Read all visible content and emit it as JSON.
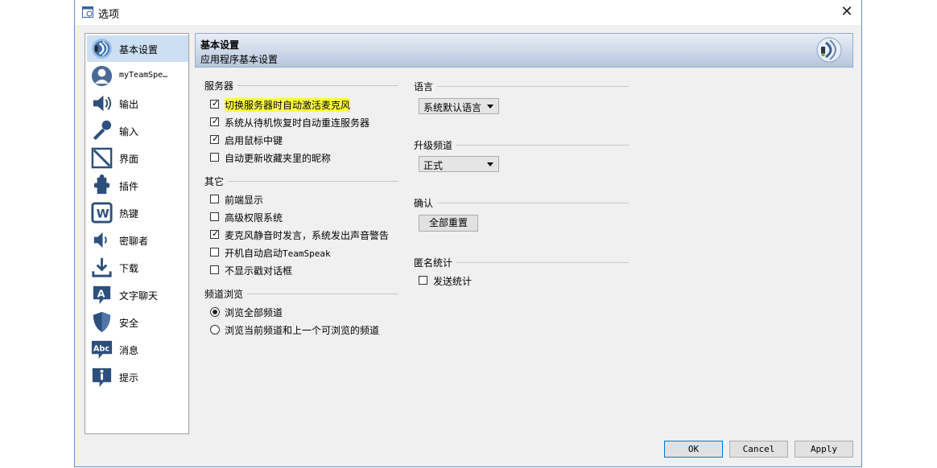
{
  "window": {
    "title": "选项",
    "close_glyph": "✕"
  },
  "sidebar": {
    "items": [
      {
        "label": "基本设置",
        "icon": "teamspeak-icon"
      },
      {
        "label": "myTeamSpe…",
        "icon": "user-icon"
      },
      {
        "label": "输出",
        "icon": "speaker-icon"
      },
      {
        "label": "输入",
        "icon": "microphone-icon"
      },
      {
        "label": "界面",
        "icon": "design-icon"
      },
      {
        "label": "插件",
        "icon": "puzzle-icon"
      },
      {
        "label": "热键",
        "icon": "keyboard-key-icon"
      },
      {
        "label": "密聊者",
        "icon": "whisper-icon"
      },
      {
        "label": "下载",
        "icon": "download-icon"
      },
      {
        "label": "文字聊天",
        "icon": "chat-icon"
      },
      {
        "label": "安全",
        "icon": "shield-icon"
      },
      {
        "label": "消息",
        "icon": "messages-icon"
      },
      {
        "label": "提示",
        "icon": "info-icon"
      }
    ],
    "selected_index": 0
  },
  "header": {
    "title": "基本设置",
    "subtitle": "应用程序基本设置"
  },
  "groups": {
    "server": {
      "title": "服务器",
      "options": [
        {
          "label": "切换服务器时自动激活麦克风",
          "checked": true
        },
        {
          "label": "系统从待机恢复时自动重连服务器",
          "checked": true
        },
        {
          "label": "启用鼠标中键",
          "checked": true
        },
        {
          "label": "自动更新收藏夹里的昵称",
          "checked": false
        }
      ]
    },
    "other": {
      "title": "其它",
      "options": [
        {
          "label": "前端显示",
          "checked": false
        },
        {
          "label": "高级权限系统",
          "checked": false
        },
        {
          "label": "麦克风静音时发言，系统发出声音警告",
          "checked": true
        },
        {
          "label_prefix": "开机自动启动",
          "label_mono": "TeamSpeak",
          "checked": false
        },
        {
          "label": "不显示戳对话框",
          "checked": false
        }
      ]
    },
    "channel_browse": {
      "title": "频道浏览",
      "options": [
        {
          "label": "浏览全部频道",
          "selected": true
        },
        {
          "label": "浏览当前频道和上一个可浏览的频道",
          "selected": false
        }
      ]
    },
    "language": {
      "title": "语言",
      "value": "系统默认语言"
    },
    "update_channel": {
      "title": "升级频道",
      "value": "正式"
    },
    "confirm": {
      "title": "确认",
      "button": "全部重置"
    },
    "anon_stats": {
      "title": "匿名统计",
      "option": {
        "label": "发送统计",
        "checked": false
      }
    }
  },
  "footer": {
    "ok": "OK",
    "cancel": "Cancel",
    "apply": "Apply"
  },
  "colors": {
    "highlight": "#ffff40",
    "selection": "#cce0f3",
    "accent": "#0078d7"
  },
  "check_glyph": "✓"
}
